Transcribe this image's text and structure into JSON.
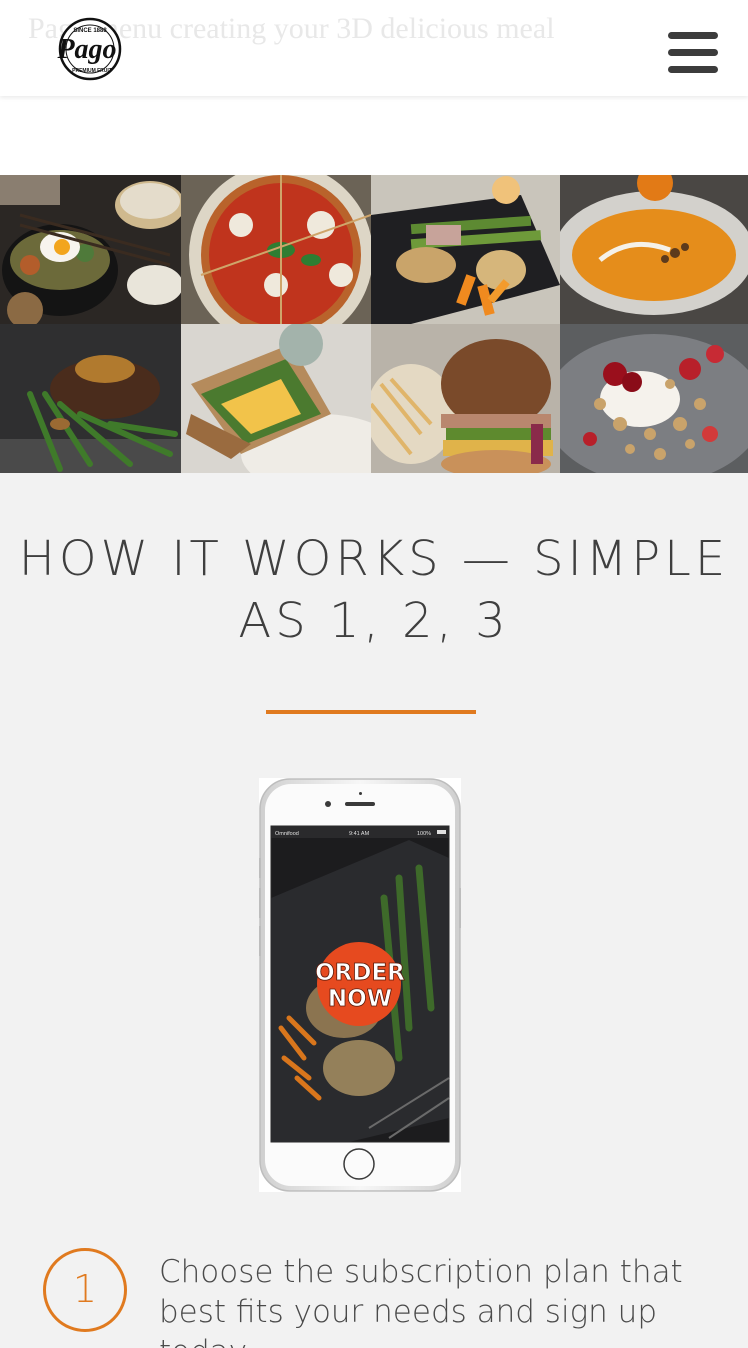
{
  "header": {
    "behind_text": "Pago menu creating your 3D delicious meal",
    "logo": {
      "brand": "Pago",
      "top_text": "SINCE 1888",
      "bottom_text": "PREMIUM FRUIT"
    },
    "menu_icon": "hamburger-menu-icon"
  },
  "gallery": {
    "tiles": [
      {
        "name": "bibimbap-dumplings",
        "alt": "bibimbap with dumplings"
      },
      {
        "name": "pizza",
        "alt": "pizza"
      },
      {
        "name": "chicken-asparagus",
        "alt": "chicken with asparagus and carrots"
      },
      {
        "name": "pumpkin-soup",
        "alt": "pumpkin soup"
      },
      {
        "name": "steak-beans",
        "alt": "steak with green beans"
      },
      {
        "name": "sandwich",
        "alt": "sandwich"
      },
      {
        "name": "burger-fries",
        "alt": "burger with fries"
      },
      {
        "name": "granola-berries",
        "alt": "granola with berries"
      }
    ]
  },
  "how_it_works": {
    "title_line1": "HOW IT WORKS — SIMPLE",
    "title_line2": "AS 1, 2, 3",
    "accent_color": "#e07a1f",
    "phone": {
      "carrier": "Omnifood",
      "time": "9:41 AM",
      "battery": "100%",
      "badge_line1": "ORDER",
      "badge_line2": "NOW"
    },
    "steps": [
      {
        "number": "1",
        "text": "Choose the subscription plan that best fits your needs and sign up today."
      }
    ]
  }
}
